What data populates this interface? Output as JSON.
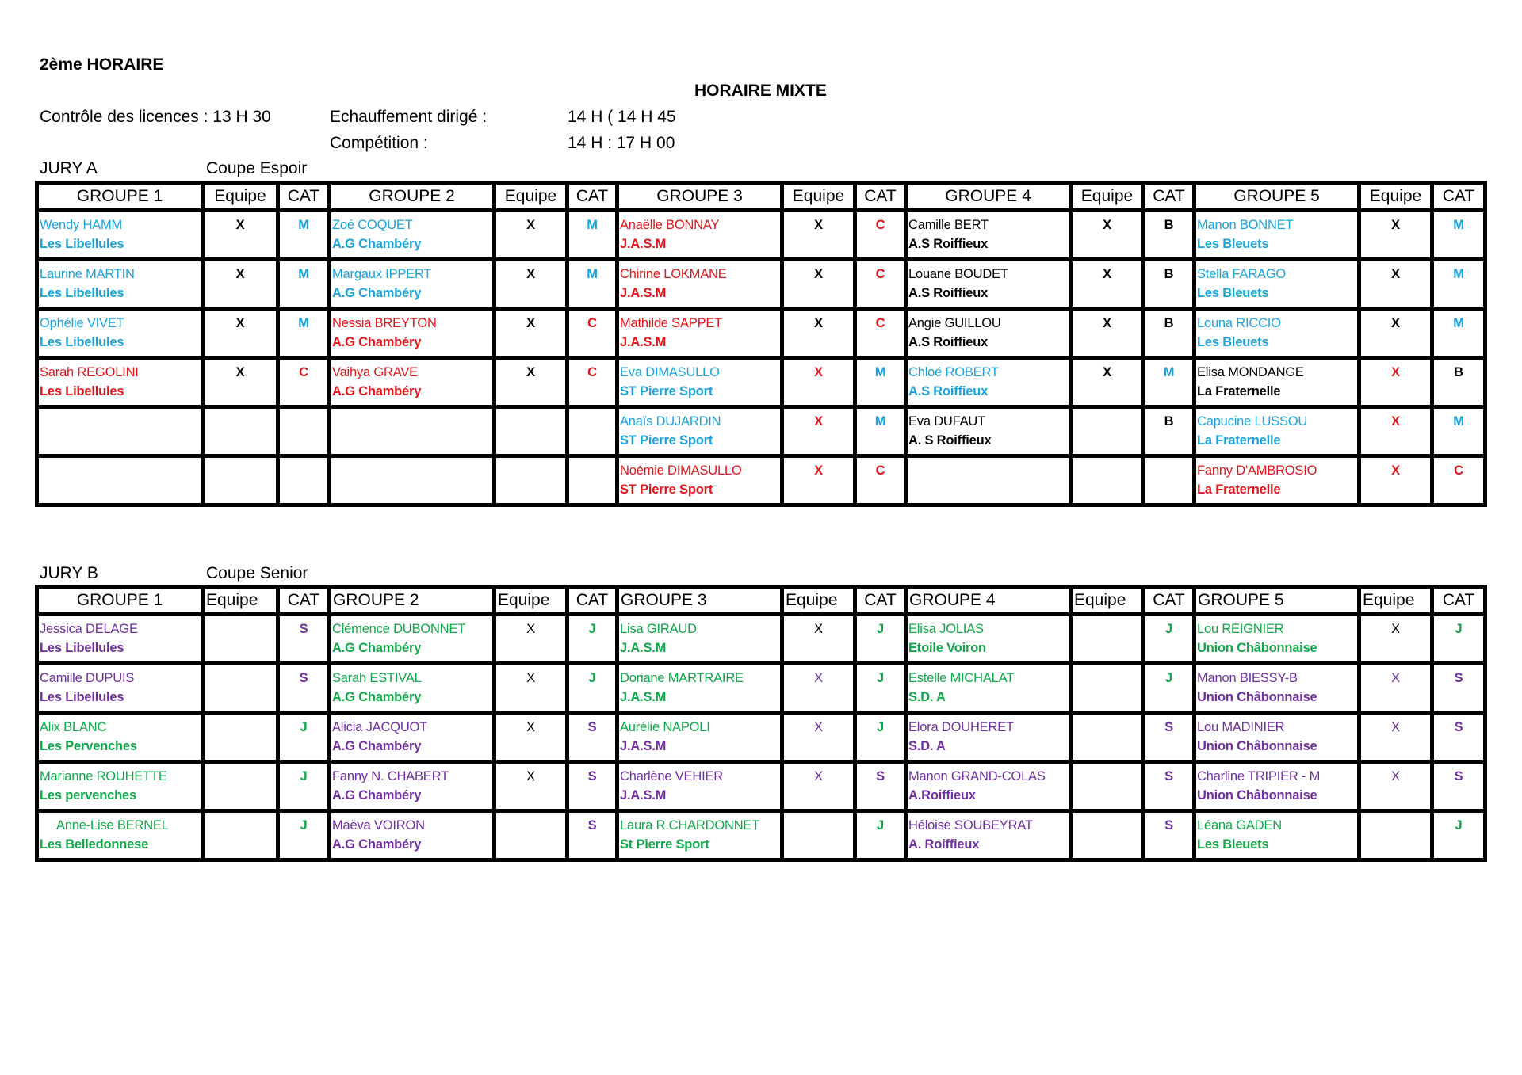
{
  "header": {
    "title": "2ème HORAIRE",
    "subtitle": "HORAIRE MIXTE",
    "licences": "Contrôle des licences : 13 H 30",
    "warmup_label": "Echauffement dirigé :",
    "warmup_time": "14 H ( 14 H 45",
    "competition_label": "Compétition :",
    "competition_time": "14 H : 17 H 00"
  },
  "palette": {
    "cy": "#1aa3dc",
    "rd": "#e5141b",
    "gr": "#11a84a",
    "pu": "#7030a0",
    "bk": "#000000"
  },
  "jury_a": {
    "jury": "JURY A",
    "cup": "Coupe Espoir",
    "headers": [
      "GROUPE 1",
      "Equipe",
      "CAT",
      "GROUPE 2",
      "Equipe",
      "CAT",
      "GROUPE 3",
      "Equipe",
      "CAT",
      "GROUPE 4",
      "Equipe",
      "CAT",
      "GROUPE 5",
      "Equipe",
      "CAT"
    ],
    "rows": [
      [
        {
          "name": "Wendy HAMM",
          "club": "Les Libellules",
          "equipe": "X",
          "cat": "M",
          "nc": "cy",
          "cc": "cy",
          "ec": "bk",
          "kc": "cy"
        },
        {
          "name": "Zoé COQUET",
          "club": "A.G Chambéry",
          "equipe": "X",
          "cat": "M",
          "nc": "cy",
          "cc": "cy",
          "ec": "bk",
          "kc": "cy"
        },
        {
          "name": "Anaëlle BONNAY",
          "club": "J.A.S.M",
          "equipe": "X",
          "cat": "C",
          "nc": "rd",
          "cc": "rd",
          "ec": "bk",
          "kc": "rd"
        },
        {
          "name": "Camille BERT",
          "club": "A.S Roiffieux",
          "equipe": "X",
          "cat": "B",
          "nc": "bk",
          "cc": "bk",
          "ec": "bk",
          "kc": "bk"
        },
        {
          "name": "Manon BONNET",
          "club": "Les Bleuets",
          "equipe": "X",
          "cat": "M",
          "nc": "cy",
          "cc": "cy",
          "ec": "bk",
          "kc": "cy"
        }
      ],
      [
        {
          "name": "Laurine MARTIN",
          "club": "Les Libellules",
          "equipe": "X",
          "cat": "M",
          "nc": "cy",
          "cc": "cy",
          "ec": "bk",
          "kc": "cy"
        },
        {
          "name": "Margaux IPPERT",
          "club": "A.G Chambéry",
          "equipe": "X",
          "cat": "M",
          "nc": "cy",
          "cc": "cy",
          "ec": "bk",
          "kc": "cy"
        },
        {
          "name": "Chirine LOKMANE",
          "club": "J.A.S.M",
          "equipe": "X",
          "cat": "C",
          "nc": "rd",
          "cc": "rd",
          "ec": "bk",
          "kc": "rd"
        },
        {
          "name": "Louane BOUDET",
          "club": "A.S Roiffieux",
          "equipe": "X",
          "cat": "B",
          "nc": "bk",
          "cc": "bk",
          "ec": "bk",
          "kc": "bk"
        },
        {
          "name": "Stella FARAGO",
          "club": "Les Bleuets",
          "equipe": "X",
          "cat": "M",
          "nc": "cy",
          "cc": "cy",
          "ec": "bk",
          "kc": "cy"
        }
      ],
      [
        {
          "name": "Ophélie VIVET",
          "club": "Les Libellules",
          "equipe": "X",
          "cat": "M",
          "nc": "cy",
          "cc": "cy",
          "ec": "bk",
          "kc": "cy"
        },
        {
          "name": "Nessia BREYTON",
          "club": "A.G Chambéry",
          "equipe": "X",
          "cat": "C",
          "nc": "rd",
          "cc": "rd",
          "ec": "bk",
          "kc": "rd"
        },
        {
          "name": "Mathilde SAPPET",
          "club": "J.A.S.M",
          "equipe": "X",
          "cat": "C",
          "nc": "rd",
          "cc": "rd",
          "ec": "bk",
          "kc": "rd"
        },
        {
          "name": "Angie GUILLOU",
          "club": "A.S Roiffieux",
          "equipe": "X",
          "cat": "B",
          "nc": "bk",
          "cc": "bk",
          "ec": "bk",
          "kc": "bk"
        },
        {
          "name": "Louna RICCIO",
          "club": "Les Bleuets",
          "equipe": "X",
          "cat": "M",
          "nc": "cy",
          "cc": "cy",
          "ec": "bk",
          "kc": "cy"
        }
      ],
      [
        {
          "name": "Sarah REGOLINI",
          "club": "Les Libellules",
          "equipe": "X",
          "cat": "C",
          "nc": "rd",
          "cc": "rd",
          "ec": "bk",
          "kc": "rd"
        },
        {
          "name": "Vaihya GRAVE",
          "club": "A.G Chambéry",
          "equipe": "X",
          "cat": "C",
          "nc": "rd",
          "cc": "rd",
          "ec": "bk",
          "kc": "rd"
        },
        {
          "name": "Eva DIMASULLO",
          "club": "ST Pierre Sport",
          "equipe": "X",
          "cat": "M",
          "nc": "cy",
          "cc": "cy",
          "ec": "rd",
          "kc": "cy"
        },
        {
          "name": "Chloé ROBERT",
          "club": "A.S Roiffieux",
          "equipe": "X",
          "cat": "M",
          "nc": "cy",
          "cc": "cy",
          "ec": "bk",
          "kc": "cy"
        },
        {
          "name": "Elisa MONDANGE",
          "club": "La Fraternelle",
          "equipe": "X",
          "cat": "B",
          "nc": "bk",
          "cc": "bk",
          "ec": "rd",
          "kc": "bk"
        }
      ],
      [
        {
          "name": "",
          "club": "",
          "equipe": "",
          "cat": ""
        },
        {
          "name": "",
          "club": "",
          "equipe": "",
          "cat": ""
        },
        {
          "name": "Anaïs DUJARDIN",
          "club": "ST Pierre Sport",
          "equipe": "X",
          "cat": "M",
          "nc": "cy",
          "cc": "cy",
          "ec": "rd",
          "kc": "cy"
        },
        {
          "name": "Eva DUFAUT",
          "club": "A. S Roiffieux",
          "equipe": "",
          "cat": "B",
          "nc": "bk",
          "cc": "bk",
          "ec": "bk",
          "kc": "bk"
        },
        {
          "name": "Capucine LUSSOU",
          "club": "La Fraternelle",
          "equipe": "X",
          "cat": "M",
          "nc": "cy",
          "cc": "cy",
          "ec": "rd",
          "kc": "cy"
        }
      ],
      [
        {
          "name": "",
          "club": "",
          "equipe": "",
          "cat": ""
        },
        {
          "name": "",
          "club": "",
          "equipe": "",
          "cat": ""
        },
        {
          "name": "Noémie DIMASULLO",
          "club": "ST Pierre Sport",
          "equipe": "X",
          "cat": "C",
          "nc": "rd",
          "cc": "rd",
          "ec": "rd",
          "kc": "rd"
        },
        {
          "name": "",
          "club": "",
          "equipe": "",
          "cat": ""
        },
        {
          "name": "Fanny D'AMBROSIO",
          "club": "La Fraternelle",
          "equipe": "X",
          "cat": "C",
          "nc": "rd",
          "cc": "rd",
          "ec": "rd",
          "kc": "rd"
        }
      ]
    ]
  },
  "jury_b": {
    "jury": "JURY B",
    "cup": "Coupe Senior",
    "headers": [
      "GROUPE 1",
      "Equipe",
      "CAT",
      "GROUPE 2",
      "Equipe",
      "CAT",
      "GROUPE 3",
      "Equipe",
      "CAT",
      "GROUPE 4",
      "Equipe",
      "CAT",
      "GROUPE 5",
      "Equipe",
      "CAT"
    ],
    "rows": [
      [
        {
          "name": "Jessica DELAGE",
          "club": "Les Libellules",
          "equipe": "",
          "cat": "S",
          "nc": "pu",
          "cc": "pu",
          "ec": "bk",
          "kc": "pu"
        },
        {
          "name": "Clémence DUBONNET",
          "club": "A.G Chambéry",
          "equipe": "X",
          "cat": "J",
          "nc": "gr",
          "cc": "gr",
          "ec": "bk",
          "kc": "gr"
        },
        {
          "name": "Lisa GIRAUD",
          "club": "J.A.S.M",
          "equipe": "X",
          "cat": "J",
          "nc": "gr",
          "cc": "gr",
          "ec": "bk",
          "kc": "gr"
        },
        {
          "name": "Elisa JOLIAS",
          "club": "Etoile Voiron",
          "equipe": "",
          "cat": "J",
          "nc": "gr",
          "cc": "gr",
          "ec": "bk",
          "kc": "gr"
        },
        {
          "name": "Lou REIGNIER",
          "club": "Union Châbonnaise",
          "equipe": "X",
          "cat": "J",
          "nc": "gr",
          "cc": "gr",
          "ec": "bk",
          "kc": "gr"
        }
      ],
      [
        {
          "name": "Camille DUPUIS",
          "club": "Les Libellules",
          "equipe": "",
          "cat": "S",
          "nc": "pu",
          "cc": "pu",
          "ec": "bk",
          "kc": "pu"
        },
        {
          "name": "Sarah ESTIVAL",
          "club": "A.G Chambéry",
          "equipe": "X",
          "cat": "J",
          "nc": "gr",
          "cc": "gr",
          "ec": "bk",
          "kc": "gr"
        },
        {
          "name": "Doriane MARTRAIRE",
          "club": "J.A.S.M",
          "equipe": "X",
          "cat": "J",
          "nc": "gr",
          "cc": "gr",
          "ec": "pu",
          "kc": "gr"
        },
        {
          "name": "Estelle MICHALAT",
          "club": "S.D. A",
          "equipe": "",
          "cat": "J",
          "nc": "gr",
          "cc": "gr",
          "ec": "bk",
          "kc": "gr"
        },
        {
          "name": "Manon BIESSY-B",
          "club": "Union Châbonnaise",
          "equipe": "X",
          "cat": "S",
          "nc": "pu",
          "cc": "pu",
          "ec": "pu",
          "kc": "pu"
        }
      ],
      [
        {
          "name": "Alix BLANC",
          "club": "Les Pervenches",
          "equipe": "",
          "cat": "J",
          "nc": "gr",
          "cc": "gr",
          "ec": "bk",
          "kc": "gr"
        },
        {
          "name": "Alicia JACQUOT",
          "club": "A.G Chambéry",
          "equipe": "X",
          "cat": "S",
          "nc": "pu",
          "cc": "pu",
          "ec": "bk",
          "kc": "pu"
        },
        {
          "name": "Aurélie NAPOLI",
          "club": "J.A.S.M",
          "equipe": "X",
          "cat": "J",
          "nc": "gr",
          "cc": "pu",
          "ec": "pu",
          "kc": "gr"
        },
        {
          "name": "Elora DOUHERET",
          "club": "S.D. A",
          "equipe": "",
          "cat": "S",
          "nc": "pu",
          "cc": "pu",
          "ec": "bk",
          "kc": "pu"
        },
        {
          "name": "Lou MADINIER",
          "club": "Union Châbonnaise",
          "equipe": "X",
          "cat": "S",
          "nc": "pu",
          "cc": "pu",
          "ec": "pu",
          "kc": "pu"
        }
      ],
      [
        {
          "name": "Marianne ROUHETTE",
          "club": "Les pervenches",
          "equipe": "",
          "cat": "J",
          "nc": "gr",
          "cc": "gr",
          "ec": "bk",
          "kc": "gr"
        },
        {
          "name": "Fanny N. CHABERT",
          "club": "A.G Chambéry",
          "equipe": "X",
          "cat": "S",
          "nc": "pu",
          "cc": "pu",
          "ec": "bk",
          "kc": "pu"
        },
        {
          "name": "Charlène VEHIER",
          "club": "J.A.S.M",
          "equipe": "X",
          "cat": "S",
          "nc": "pu",
          "cc": "pu",
          "ec": "pu",
          "kc": "pu"
        },
        {
          "name": "Manon GRAND-COLAS",
          "club": "A.Roiffieux",
          "equipe": "",
          "cat": "S",
          "nc": "pu",
          "cc": "pu",
          "ec": "bk",
          "kc": "pu"
        },
        {
          "name": "Charline TRIPIER - M",
          "club": "Union Châbonnaise",
          "equipe": "X",
          "cat": "S",
          "nc": "pu",
          "cc": "pu",
          "ec": "pu",
          "kc": "pu"
        }
      ],
      [
        {
          "name": "     Anne-Lise BERNEL",
          "club": "Les Belledonnese",
          "equipe": "",
          "cat": "J",
          "nc": "gr",
          "cc": "gr",
          "ec": "bk",
          "kc": "gr"
        },
        {
          "name": "Maëva VOIRON",
          "club": "A.G Chambéry",
          "equipe": "",
          "cat": "S",
          "nc": "pu",
          "cc": "pu",
          "ec": "bk",
          "kc": "pu"
        },
        {
          "name": "Laura R.CHARDONNET",
          "club": "St Pierre Sport",
          "equipe": "",
          "cat": "J",
          "nc": "gr",
          "cc": "gr",
          "ec": "bk",
          "kc": "gr"
        },
        {
          "name": "Héloise SOUBEYRAT",
          "club": "A. Roiffieux",
          "equipe": "",
          "cat": "S",
          "nc": "pu",
          "cc": "pu",
          "ec": "bk",
          "kc": "pu"
        },
        {
          "name": "Léana GADEN",
          "club": "Les Bleuets",
          "equipe": "",
          "cat": "J",
          "nc": "gr",
          "cc": "gr",
          "ec": "bk",
          "kc": "gr"
        }
      ]
    ]
  }
}
